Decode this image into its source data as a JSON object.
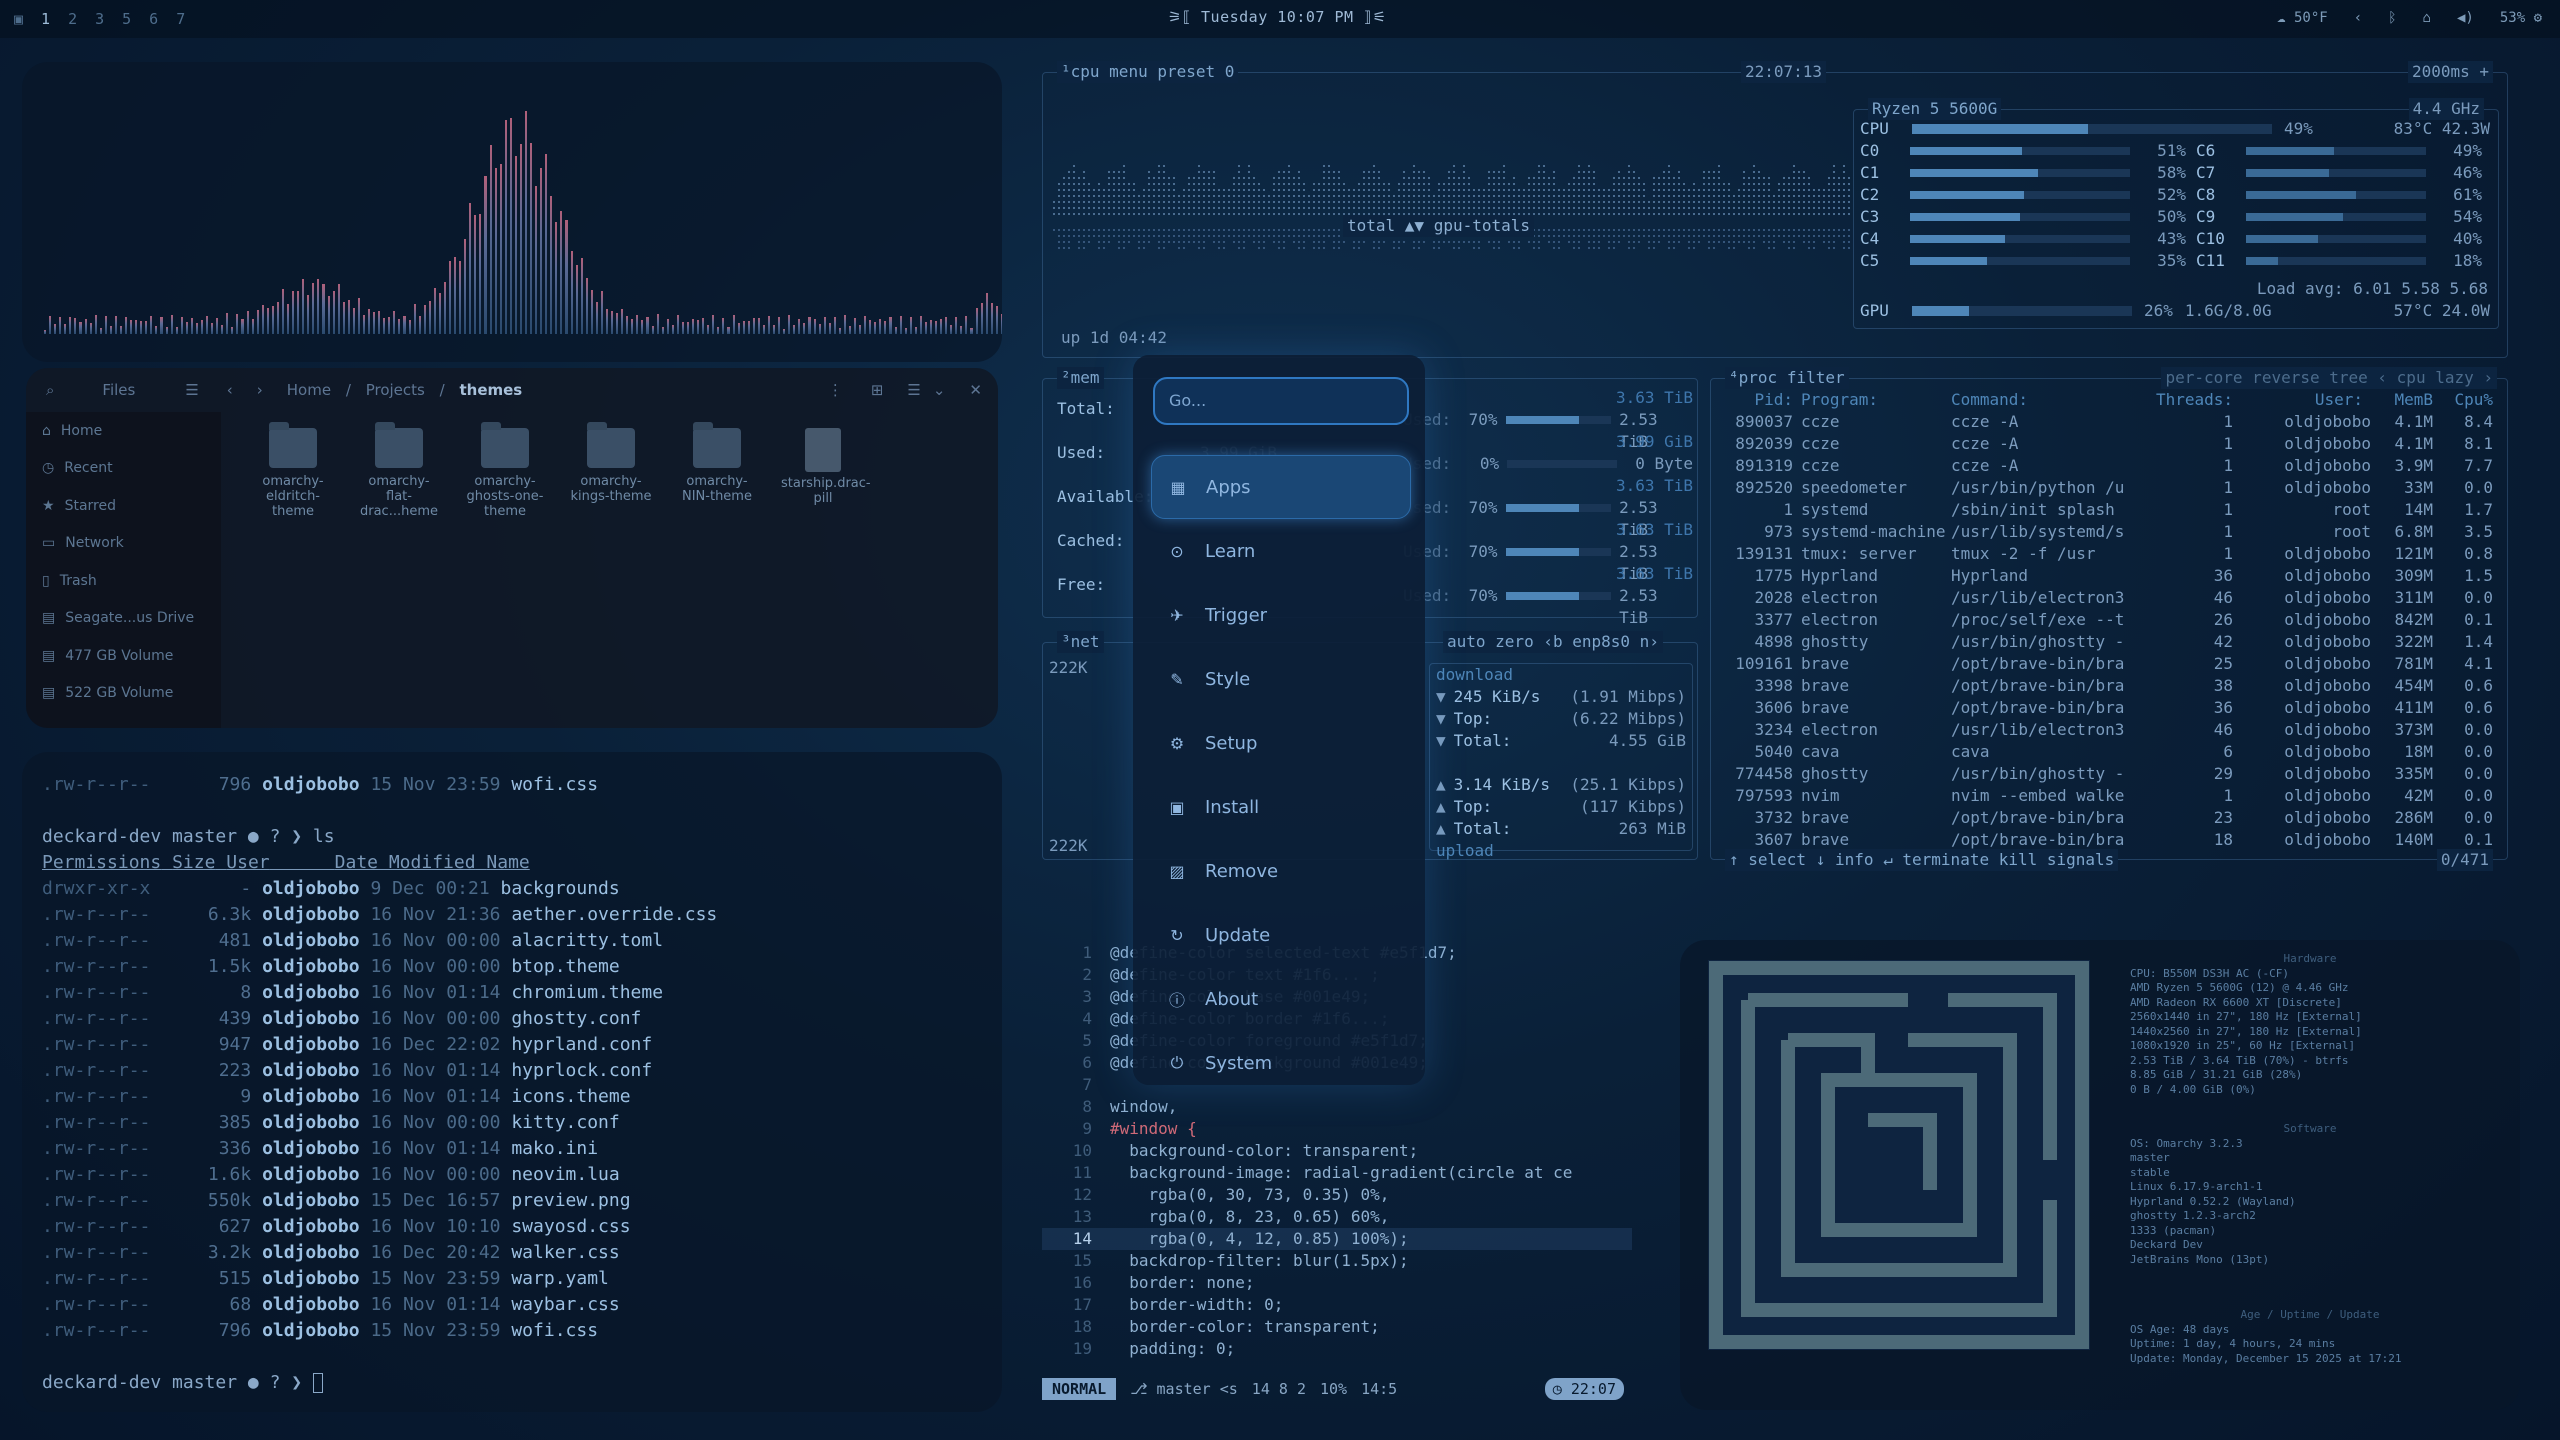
{
  "topbar": {
    "workspaces": [
      "1",
      "2",
      "3",
      "5",
      "6",
      "7"
    ],
    "clock": "Tuesday 10:07 PM",
    "weather": "50°F",
    "battery": "53%"
  },
  "files": {
    "breadcrumb": [
      "Home",
      "Projects",
      "themes"
    ],
    "sidebar": [
      "Home",
      "Recent",
      "Starred",
      "Network",
      "Trash",
      "Seagate...us Drive",
      "477 GB Volume",
      "522 GB Volume"
    ],
    "items": [
      {
        "label": "omarchy-eldritch-theme",
        "type": "folder"
      },
      {
        "label": "omarchy-flat-drac...heme",
        "type": "folder"
      },
      {
        "label": "omarchy-ghosts-one-theme",
        "type": "folder"
      },
      {
        "label": "omarchy-kings-theme",
        "type": "folder"
      },
      {
        "label": "omarchy-NIN-theme",
        "type": "folder"
      },
      {
        "label": "starship.drac-pill",
        "type": "file"
      }
    ]
  },
  "terminal": {
    "prompt": "deckard-dev master ● ? ❯ ls",
    "prompt_end": "deckard-dev master ● ? ❯",
    "headers": [
      "Permissions",
      "Size",
      "User",
      "Date Modified",
      "Name"
    ],
    "first_row": {
      "perm": ".rw-r--r--",
      "size": "796",
      "user": "oldjobobo",
      "date": "15 Nov 23:59",
      "name": "wofi.css"
    },
    "rows": [
      {
        "perm": "drwxr-xr-x",
        "size": "-",
        "user": "oldjobobo",
        "date": "9 Dec 00:21",
        "name": "backgrounds"
      },
      {
        "perm": ".rw-r--r--",
        "size": "6.3k",
        "user": "oldjobobo",
        "date": "16 Nov 21:36",
        "name": "aether.override.css"
      },
      {
        "perm": ".rw-r--r--",
        "size": "481",
        "user": "oldjobobo",
        "date": "16 Nov 00:00",
        "name": "alacritty.toml"
      },
      {
        "perm": ".rw-r--r--",
        "size": "1.5k",
        "user": "oldjobobo",
        "date": "16 Nov 00:00",
        "name": "btop.theme"
      },
      {
        "perm": ".rw-r--r--",
        "size": "8",
        "user": "oldjobobo",
        "date": "16 Nov 01:14",
        "name": "chromium.theme"
      },
      {
        "perm": ".rw-r--r--",
        "size": "439",
        "user": "oldjobobo",
        "date": "16 Nov 00:00",
        "name": "ghostty.conf"
      },
      {
        "perm": ".rw-r--r--",
        "size": "947",
        "user": "oldjobobo",
        "date": "16 Dec 22:02",
        "name": "hyprland.conf"
      },
      {
        "perm": ".rw-r--r--",
        "size": "223",
        "user": "oldjobobo",
        "date": "16 Nov 01:14",
        "name": "hyprlock.conf"
      },
      {
        "perm": ".rw-r--r--",
        "size": "9",
        "user": "oldjobobo",
        "date": "16 Nov 01:14",
        "name": "icons.theme"
      },
      {
        "perm": ".rw-r--r--",
        "size": "385",
        "user": "oldjobobo",
        "date": "16 Nov 00:00",
        "name": "kitty.conf"
      },
      {
        "perm": ".rw-r--r--",
        "size": "336",
        "user": "oldjobobo",
        "date": "16 Nov 01:14",
        "name": "mako.ini"
      },
      {
        "perm": ".rw-r--r--",
        "size": "1.6k",
        "user": "oldjobobo",
        "date": "16 Nov 00:00",
        "name": "neovim.lua"
      },
      {
        "perm": ".rw-r--r--",
        "size": "550k",
        "user": "oldjobobo",
        "date": "15 Dec 16:57",
        "name": "preview.png"
      },
      {
        "perm": ".rw-r--r--",
        "size": "627",
        "user": "oldjobobo",
        "date": "16 Nov 10:10",
        "name": "swayosd.css"
      },
      {
        "perm": ".rw-r--r--",
        "size": "3.2k",
        "user": "oldjobobo",
        "date": "16 Dec 20:42",
        "name": "walker.css"
      },
      {
        "perm": ".rw-r--r--",
        "size": "515",
        "user": "oldjobobo",
        "date": "15 Nov 23:59",
        "name": "warp.yaml"
      },
      {
        "perm": ".rw-r--r--",
        "size": "68",
        "user": "oldjobobo",
        "date": "16 Nov 01:14",
        "name": "waybar.css"
      },
      {
        "perm": ".rw-r--r--",
        "size": "796",
        "user": "oldjobobo",
        "date": "15 Nov 23:59",
        "name": "wofi.css"
      }
    ]
  },
  "btop": {
    "cpu_tabs": [
      "¹cpu",
      "menu",
      "preset 0"
    ],
    "time": "22:07:13",
    "interval": "2000ms",
    "cpu_name": "Ryzen 5 5600G",
    "cpu_freq": "4.4 GHz",
    "cpu_total": {
      "label": "CPU",
      "pct": "49%",
      "temp": "83°C 42.3W"
    },
    "cores_left": [
      {
        "label": "C0",
        "pct": "51%"
      },
      {
        "label": "C1",
        "pct": "58%"
      },
      {
        "label": "C2",
        "pct": "52%"
      },
      {
        "label": "C3",
        "pct": "50%"
      },
      {
        "label": "C4",
        "pct": "43%"
      },
      {
        "label": "C5",
        "pct": "35%"
      }
    ],
    "cores_right": [
      {
        "label": "C6",
        "pct": "49%"
      },
      {
        "label": "C7",
        "pct": "46%"
      },
      {
        "label": "C8",
        "pct": "61%"
      },
      {
        "label": "C9",
        "pct": "54%"
      },
      {
        "label": "C10",
        "pct": "40%"
      },
      {
        "label": "C11",
        "pct": "18%"
      }
    ],
    "load": "Load avg: 6.01 5.58 5.68",
    "gpu": {
      "label": "GPU",
      "pct": "26%",
      "mem": "1.6G/8.0G",
      "temp": "57°C 24.0W"
    },
    "graph_label": "total ▲▼ gpu-totals",
    "uptime": "up 1d 04:42",
    "mem": {
      "title": "²mem",
      "rows": [
        {
          "label": "Total:",
          "val": "3.63 TiB"
        },
        {
          "label": "Used:",
          "val": "3.99 GiB"
        },
        {
          "label": "Available:",
          "val": ""
        },
        {
          "label": "Cached:",
          "val": ""
        },
        {
          "label": "Free:",
          "val": ""
        }
      ],
      "disks": [
        {
          "label": "Used:",
          "pct": "70%",
          "val": "2.53 TiB",
          "total": "3.63 TiB"
        },
        {
          "label": "Used:",
          "pct": "0%",
          "val": "0 Byte",
          "total": "3.99 GiB"
        },
        {
          "label": "Used:",
          "pct": "70%",
          "val": "2.53 TiB",
          "total": "3.63 TiB"
        },
        {
          "label": "Used:",
          "pct": "70%",
          "val": "2.53 TiB",
          "total": "3.63 TiB"
        },
        {
          "label": "Used:",
          "pct": "70%",
          "val": "2.53 TiB",
          "total": "3.63 TiB"
        }
      ]
    },
    "net": {
      "title": "³net",
      "top_scale": "222K",
      "bottom_scale": "222K",
      "tabs": "auto zero ‹b enp8s0 n›",
      "download_label": "download",
      "download": [
        {
          "arrow": "▼",
          "label": "245 KiB/s",
          "val": "(1.91 Mibps)"
        },
        {
          "arrow": "▼",
          "label": "Top:",
          "val": "(6.22 Mibps)"
        },
        {
          "arrow": "▼",
          "label": "Total:",
          "val": "4.55 GiB"
        }
      ],
      "upload_label": "upload",
      "upload": [
        {
          "arrow": "▲",
          "label": "3.14 KiB/s",
          "val": "(25.1 Kibps)"
        },
        {
          "arrow": "▲",
          "label": "Top:",
          "val": "(117 Kibps)"
        },
        {
          "arrow": "▲",
          "label": "Total:",
          "val": "263 MiB"
        }
      ]
    },
    "proc": {
      "title": "⁴proc",
      "filter": "filter",
      "tabs": "per-core  reverse  tree  ‹ cpu lazy ›",
      "headers": [
        "Pid:",
        "Program:",
        "Command:",
        "Threads:",
        "User:",
        "MemB",
        "Cpu%"
      ],
      "rows": [
        [
          "890037",
          "ccze",
          "ccze -A",
          "1",
          "oldjobobo",
          "4.1M",
          "8.4"
        ],
        [
          "892039",
          "ccze",
          "ccze -A",
          "1",
          "oldjobobo",
          "4.1M",
          "8.1"
        ],
        [
          "891319",
          "ccze",
          "ccze -A",
          "1",
          "oldjobobo",
          "3.9M",
          "7.7"
        ],
        [
          "892520",
          "speedometer",
          "/usr/bin/python /u",
          "1",
          "oldjobobo",
          "33M",
          "0.0"
        ],
        [
          "1",
          "systemd",
          "/sbin/init splash",
          "1",
          "root",
          "14M",
          "1.7"
        ],
        [
          "973",
          "systemd-machine",
          "/usr/lib/systemd/s",
          "1",
          "root",
          "6.8M",
          "3.5"
        ],
        [
          "139131",
          "tmux: server",
          "tmux -2 -f /usr",
          "1",
          "oldjobobo",
          "121M",
          "0.8"
        ],
        [
          "1775",
          "Hyprland",
          "Hyprland",
          "36",
          "oldjobobo",
          "309M",
          "1.5"
        ],
        [
          "2028",
          "electron",
          "/usr/lib/electron3",
          "46",
          "oldjobobo",
          "311M",
          "0.0"
        ],
        [
          "3377",
          "electron",
          "/proc/self/exe --t",
          "26",
          "oldjobobo",
          "842M",
          "0.1"
        ],
        [
          "4898",
          "ghostty",
          "/usr/bin/ghostty -",
          "42",
          "oldjobobo",
          "322M",
          "1.4"
        ],
        [
          "109161",
          "brave",
          "/opt/brave-bin/bra",
          "25",
          "oldjobobo",
          "781M",
          "4.1"
        ],
        [
          "3398",
          "brave",
          "/opt/brave-bin/bra",
          "38",
          "oldjobobo",
          "454M",
          "0.6"
        ],
        [
          "3606",
          "brave",
          "/opt/brave-bin/bra",
          "36",
          "oldjobobo",
          "411M",
          "0.6"
        ],
        [
          "3234",
          "electron",
          "/usr/lib/electron3",
          "46",
          "oldjobobo",
          "373M",
          "0.0"
        ],
        [
          "5040",
          "cava",
          "cava",
          "6",
          "oldjobobo",
          "18M",
          "0.0"
        ],
        [
          "774458",
          "ghostty",
          "/usr/bin/ghostty -",
          "29",
          "oldjobobo",
          "335M",
          "0.0"
        ],
        [
          "797593",
          "nvim",
          "nvim --embed walke",
          "1",
          "oldjobobo",
          "42M",
          "0.0"
        ],
        [
          "3732",
          "brave",
          "/opt/brave-bin/bra",
          "23",
          "oldjobobo",
          "286M",
          "0.0"
        ],
        [
          "3607",
          "brave",
          "/opt/brave-bin/bra",
          "18",
          "oldjobobo",
          "140M",
          "0.1"
        ]
      ],
      "footer": "↑ select ↓   info ↵   terminate   kill   signals",
      "count": "0/471"
    }
  },
  "editor": {
    "lines": [
      {
        "n": "1",
        "t": "@define-color selected-text #e5f1d7;"
      },
      {
        "n": "2",
        "t": "@define-color text #1f6... ;"
      },
      {
        "n": "3",
        "t": "@define-color base #001e49;"
      },
      {
        "n": "4",
        "t": "@define-color border #1f6...;"
      },
      {
        "n": "5",
        "t": "@define-color foreground #e5f1d7;"
      },
      {
        "n": "6",
        "t": "@define-color background #001e49;"
      },
      {
        "n": "7",
        "t": ""
      },
      {
        "n": "8",
        "t": "window,"
      },
      {
        "n": "9",
        "t": "#window {"
      },
      {
        "n": "10",
        "t": "  background-color: transparent;"
      },
      {
        "n": "11",
        "t": "  background-image: radial-gradient(circle at ce"
      },
      {
        "n": "12",
        "t": "    rgba(0, 30, 73, 0.35) 0%,"
      },
      {
        "n": "13",
        "t": "    rgba(0, 8, 23, 0.65) 60%,"
      },
      {
        "n": "14",
        "t": "    rgba(0, 4, 12, 0.85) 100%);"
      },
      {
        "n": "15",
        "t": "  backdrop-filter: blur(1.5px);"
      },
      {
        "n": "16",
        "t": "  border: none;"
      },
      {
        "n": "17",
        "t": "  border-width: 0;"
      },
      {
        "n": "18",
        "t": "  border-color: transparent;"
      },
      {
        "n": "19",
        "t": "  padding: 0;"
      }
    ],
    "status": {
      "mode": "NORMAL",
      "branch": "master <s",
      "counts": "14  8  2",
      "pct": "10%",
      "pos": "14:5",
      "time": "22:07"
    }
  },
  "fastfetch": {
    "hardware_title": "Hardware",
    "hardware": [
      "CPU: B550M DS3H AC (-CF)",
      "AMD Ryzen 5 5600G (12) @ 4.46 GHz",
      "AMD Radeon RX 6600 XT [Discrete]",
      "2560x1440 in 27\", 180 Hz [External]",
      "1440x2560 in 27\", 180 Hz [External]",
      "1080x1920 in 25\", 60 Hz [External]",
      "2.53 TiB / 3.64 TiB (70%) - btrfs",
      "8.85 GiB / 31.21 GiB (28%)",
      "0 B / 4.00 GiB (0%)"
    ],
    "software_title": "Software",
    "software": [
      "OS: Omarchy 3.2.3",
      "master",
      "stable",
      "Linux 6.17.9-arch1-1",
      "Hyprland 0.52.2 (Wayland)",
      "ghostty 1.2.3-arch2",
      "1333 (pacman)",
      "Deckard Dev",
      "JetBrains Mono (13pt)"
    ],
    "age_title": "Age / Uptime / Update",
    "age": [
      "OS Age: 48 days",
      "Uptime: 1 day, 4 hours, 24 mins",
      "Update: Monday, December 15 2025 at 17:21"
    ]
  },
  "walker": {
    "placeholder": "Go...",
    "items": [
      {
        "label": "Apps",
        "icon": "grid-icon",
        "glyph": "▦"
      },
      {
        "label": "Learn",
        "icon": "learn-icon",
        "glyph": "⊙"
      },
      {
        "label": "Trigger",
        "icon": "rocket-icon",
        "glyph": "✈"
      },
      {
        "label": "Style",
        "icon": "brush-icon",
        "glyph": "✎"
      },
      {
        "label": "Setup",
        "icon": "gear-icon",
        "glyph": "⚙"
      },
      {
        "label": "Install",
        "icon": "install-icon",
        "glyph": "▣"
      },
      {
        "label": "Remove",
        "icon": "remove-icon",
        "glyph": "▨"
      },
      {
        "label": "Update",
        "icon": "refresh-icon",
        "glyph": "↻"
      },
      {
        "label": "About",
        "icon": "info-icon",
        "glyph": "ⓘ"
      },
      {
        "label": "System",
        "icon": "power-icon",
        "glyph": "⏻"
      }
    ]
  },
  "colors": {
    "accent": "#2f78c2",
    "selected": "#1a4775",
    "bg": "#0a2038"
  }
}
